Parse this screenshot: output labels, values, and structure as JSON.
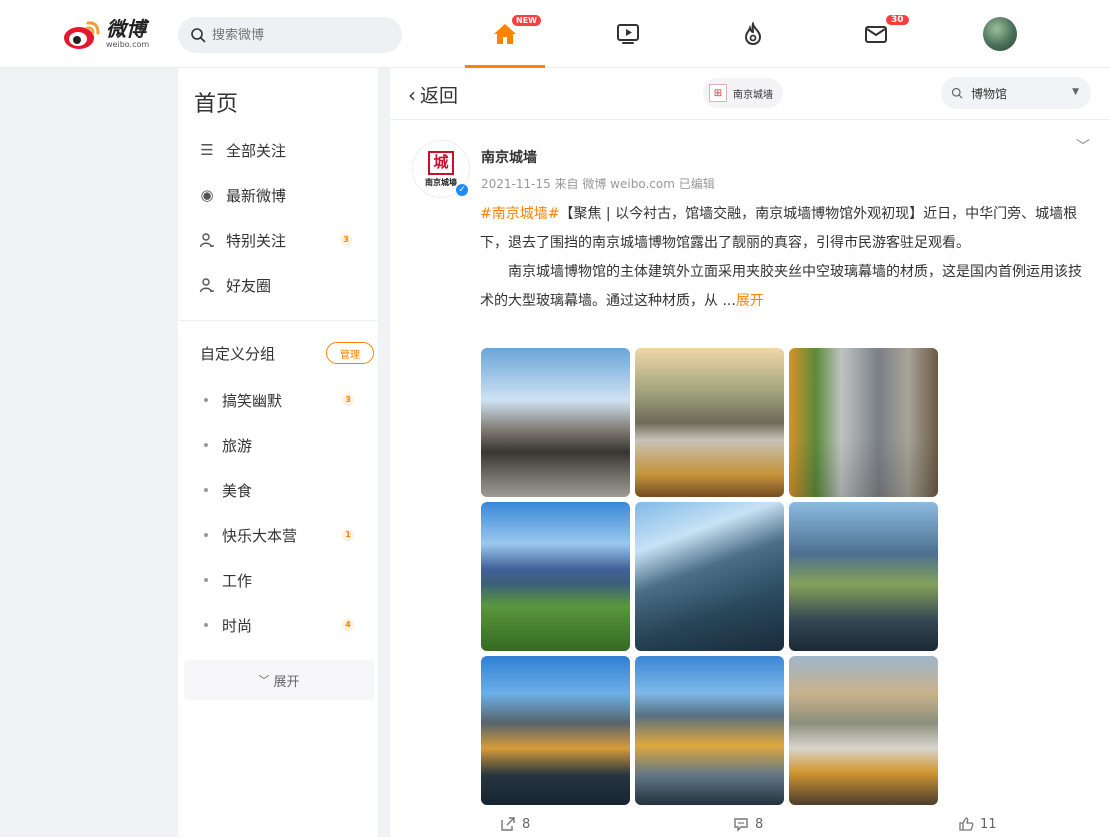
{
  "topbar": {
    "logo_cn": "微博",
    "logo_en": "weibo.com",
    "search_placeholder": "搜索微博",
    "home_badge": "NEW",
    "message_badge": "30"
  },
  "sidebar": {
    "title": "首页",
    "menu": [
      {
        "label": "全部关注",
        "icon": "list-icon",
        "count": ""
      },
      {
        "label": "最新微博",
        "icon": "radio-icon",
        "count": ""
      },
      {
        "label": "特别关注",
        "icon": "user-star-icon",
        "count": "3"
      },
      {
        "label": "好友圈",
        "icon": "user-group-icon",
        "count": ""
      }
    ],
    "group_title": "自定义分组",
    "manage_label": "管理",
    "groups": [
      {
        "label": "搞笑幽默",
        "count": "3"
      },
      {
        "label": "旅游",
        "count": ""
      },
      {
        "label": "美食",
        "count": ""
      },
      {
        "label": "快乐大本营",
        "count": "1"
      },
      {
        "label": "工作",
        "count": ""
      },
      {
        "label": "时尚",
        "count": "4"
      }
    ],
    "expand_label": "展开"
  },
  "main": {
    "back_label": "返回",
    "tag_label": "南京城墙",
    "search_value": "博物馆"
  },
  "post": {
    "author": "南京城墙",
    "avatar_seal": "城",
    "avatar_text": "南京城墙",
    "meta": "2021-11-15 来自 微博 weibo.com 已编辑",
    "hashtag": "#南京城墙#",
    "text1": "【聚焦 | 以今衬古，馆墙交融，南京城墙博物馆外观初现】近日，中华门旁、城墙根下，退去了围挡的南京城墙博物馆露出了靓丽的真容，引得市民游客驻足观看。",
    "text2": "南京城墙博物馆的主体建筑外立面采用夹胶夹丝中空玻璃幕墙的材质，这是国内首例运用该技术的大型玻璃幕墙。通过这种材质，从 ...",
    "more_label": "展开",
    "repost_count": "8",
    "comment_count": "8",
    "like_count": "11"
  },
  "colors": {
    "accent": "#ff8200",
    "badge": "#ff3d3d",
    "verified": "#1d8cf0"
  }
}
